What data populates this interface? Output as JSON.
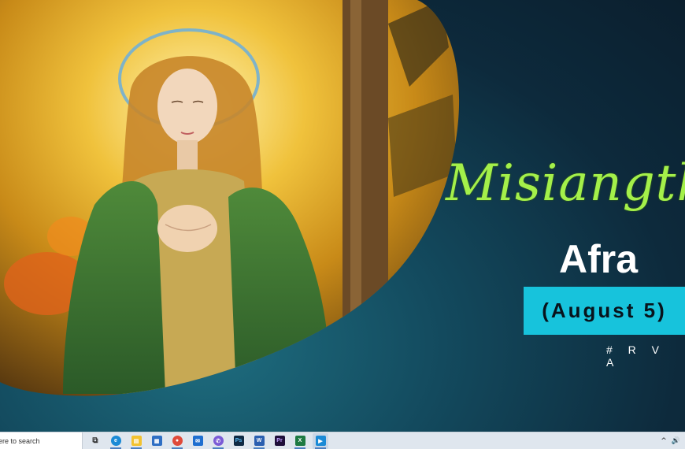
{
  "poster": {
    "script_title": "Misiangtho",
    "saint_name": "Afra",
    "feast_date": "(August 5)",
    "hashtag": "# R V A"
  },
  "colors": {
    "background_dark": "#0b1f2e",
    "teal": "#1e6e80",
    "script_green": "#a4f04a",
    "date_box": "#17c3dc"
  },
  "taskbar": {
    "search_placeholder": "ere to search",
    "icons": [
      {
        "name": "task-view-icon",
        "label": "⧉"
      },
      {
        "name": "edge-icon",
        "label": "e"
      },
      {
        "name": "file-explorer-icon",
        "label": "▤"
      },
      {
        "name": "store-icon",
        "label": "▦"
      },
      {
        "name": "chrome-icon",
        "label": "●"
      },
      {
        "name": "mail-icon",
        "label": "✉"
      },
      {
        "name": "viber-icon",
        "label": "✆"
      },
      {
        "name": "photoshop-icon",
        "label": "Ps"
      },
      {
        "name": "word-icon",
        "label": "W"
      },
      {
        "name": "premiere-icon",
        "label": "Pr"
      },
      {
        "name": "excel-icon",
        "label": "X"
      },
      {
        "name": "photos-icon",
        "label": "▶"
      }
    ],
    "tray": {
      "chevron": "^",
      "volume": "🔊"
    }
  }
}
